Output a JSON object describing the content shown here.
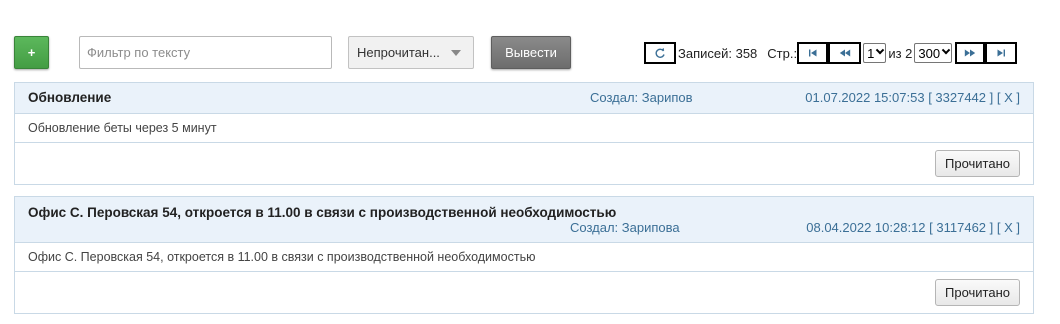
{
  "toolbar": {
    "add_label": "+",
    "filter_placeholder": "Фильтр по тексту",
    "filter_value": "",
    "status_selected": "Непрочитан...",
    "output_label": "Вывести"
  },
  "pager": {
    "records_label": "Записей: 358",
    "page_label": "Стр.:",
    "current_page": "1",
    "of_label": "из 2",
    "page_size": "300"
  },
  "notifications": [
    {
      "title": "Обновление",
      "author_label": "Создал:",
      "author": "Зарипов",
      "datetime": "01.07.2022 15:07:53",
      "id": "[ 3327442 ]",
      "close": "[ X ]",
      "body": "Обновление беты через 5 минут",
      "read_button": "Прочитано"
    },
    {
      "title": "Офис С. Перовская 54, откроется в 11.00 в связи с производственной необходимостью",
      "author_label": "Создал:",
      "author": "Зарипова",
      "datetime": "08.04.2022 10:28:12",
      "id": "[ 3117462 ]",
      "close": "[ X ]",
      "body": "Офис С. Перовская 54, откроется в 11.00 в связи с производственной необходимостью",
      "read_button": "Прочитано"
    }
  ],
  "icons": {
    "refresh": "refresh-icon",
    "first": "first-page-icon",
    "prev": "prev-page-icon",
    "next": "next-page-icon",
    "last": "last-page-icon",
    "caret": "caret-down-icon"
  },
  "colors": {
    "add_button": "#4cae4c",
    "output_button": "#7a7a7a",
    "card_header": "#eaf2fa",
    "card_border": "#c9d9e6",
    "link": "#3b6f96"
  }
}
